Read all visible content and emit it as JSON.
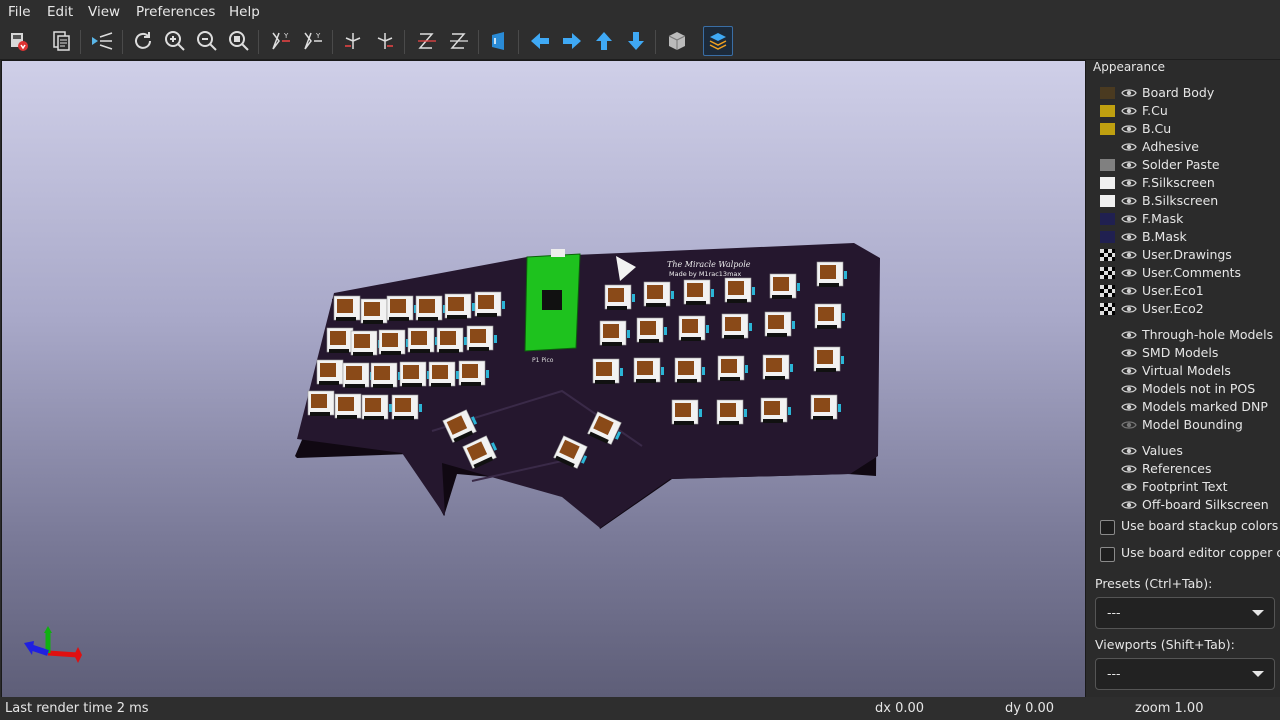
{
  "menu": [
    "File",
    "Edit",
    "View",
    "Preferences",
    "Help"
  ],
  "toolbar": {
    "icons": [
      "export-icon",
      "copy-icon",
      "raytrace-icon",
      "reload-icon",
      "zoom-in-icon",
      "zoom-out-icon",
      "zoom-fit-icon",
      "rotate-x-cw-icon",
      "rotate-x-ccw-icon",
      "rotate-y-cw-icon",
      "rotate-y-ccw-icon",
      "rotate-z-cw-icon",
      "rotate-z-ccw-icon",
      "flip-board-icon",
      "move-left-icon",
      "move-right-icon",
      "move-up-icon",
      "move-down-icon",
      "ortho-icon",
      "toggle-panel-icon"
    ]
  },
  "panel": {
    "title": "Appearance",
    "layers": [
      {
        "label": "Board Body",
        "color": "#4a3a20"
      },
      {
        "label": "F.Cu",
        "color": "#bfa010"
      },
      {
        "label": "B.Cu",
        "color": "#bfa010"
      },
      {
        "label": "Adhesive",
        "color": ""
      },
      {
        "label": "Solder Paste",
        "color": "#808080"
      },
      {
        "label": "F.Silkscreen",
        "color": "#f0f0f0"
      },
      {
        "label": "B.Silkscreen",
        "color": "#f0f0f0"
      },
      {
        "label": "F.Mask",
        "color": "#202050"
      },
      {
        "label": "B.Mask",
        "color": "#202050"
      },
      {
        "label": "User.Drawings",
        "color": "checker"
      },
      {
        "label": "User.Comments",
        "color": "checker"
      },
      {
        "label": "User.Eco1",
        "color": "checker"
      },
      {
        "label": "User.Eco2",
        "color": "checker"
      }
    ],
    "models": [
      "Through-hole Models",
      "SMD Models",
      "Virtual Models",
      "Models not in POS",
      "Models marked DNP",
      "Model Bounding"
    ],
    "text_items": [
      "Values",
      "References",
      "Footprint Text",
      "Off-board Silkscreen"
    ],
    "checkbox_stackup": "Use board stackup colors",
    "checkbox_copper": "Use board editor copper colors",
    "presets_label": "Presets (Ctrl+Tab):",
    "presets_value": "---",
    "viewports_label": "Viewports (Shift+Tab):",
    "viewports_value": "---"
  },
  "board": {
    "title_text": "The Miracle Walpole",
    "subtitle_text": "Made by M1rac13max",
    "mcu_label": "P1 Pico",
    "colors": {
      "board": "#25172e",
      "mcu": "#1ec21e",
      "keycap": "#f2f2f2",
      "switch": "#8a4a18"
    }
  },
  "status": {
    "render": "Last render time 2 ms",
    "dx": "dx 0.00",
    "dy": "dy 0.00",
    "zoom": "zoom 1.00"
  }
}
